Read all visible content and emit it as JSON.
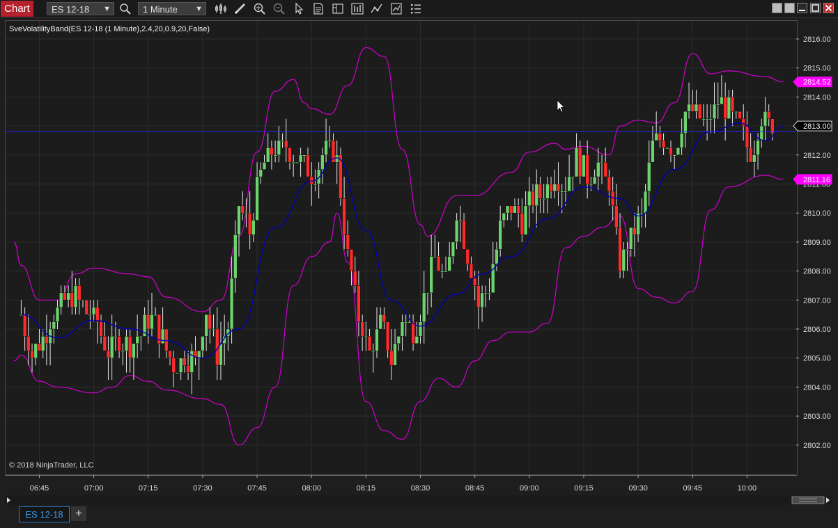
{
  "window": {
    "tab_label": "Chart",
    "instrument_dropdown": "ES 12-18",
    "interval_dropdown": "1 Minute",
    "toolbar_icons": [
      "search-icon",
      "bar-style-icon",
      "drawing-tools-icon",
      "zoom-in-icon",
      "zoom-out-icon",
      "select-pointer-icon",
      "data-box-icon",
      "chart-trader-icon",
      "indicators-icon",
      "strategies-icon",
      "properties-icon",
      "list-icon"
    ],
    "window_buttons": [
      "tile-left-icon",
      "tile-right-icon",
      "minimize-icon",
      "maximize-icon",
      "close-icon"
    ]
  },
  "chart": {
    "indicator_label": "SveVolatilityBand(ES 12-18 (1 Minute),2.4,20,0.9,20,False)",
    "copyright": "© 2018 NinjaTrader, LLC",
    "y_axis_labels": [
      "2816.00",
      "2815.00",
      "2814.00",
      "2813.00",
      "2812.00",
      "2811.00",
      "2810.00",
      "2809.00",
      "2808.00",
      "2807.00",
      "2806.00",
      "2805.00",
      "2804.00",
      "2803.00",
      "2802.00"
    ],
    "x_axis_labels": [
      "06:45",
      "07:00",
      "07:15",
      "07:30",
      "07:45",
      "08:00",
      "08:15",
      "08:30",
      "08:45",
      "09:00",
      "09:15",
      "09:30",
      "09:45",
      "10:00"
    ],
    "price_markers": [
      {
        "label": "2814.52",
        "value": 2814.52,
        "style": "upper-band",
        "color": "#ff00ff"
      },
      {
        "label": "2813.00",
        "value": 2813.0,
        "style": "last-price",
        "color": "#000000"
      },
      {
        "label": "2811.16",
        "value": 2811.16,
        "style": "lower-band",
        "color": "#ff00ff"
      }
    ]
  },
  "chart_data": {
    "type": "candlestick",
    "instrument": "ES 12-18",
    "interval": "1 Minute",
    "ylim": [
      2801.2,
      2816.7
    ],
    "x_range": [
      "06:38",
      "10:10"
    ],
    "grid": true,
    "colors": {
      "up": "#6cd46c",
      "down": "#ff2a2a",
      "band": "#d000d0",
      "middle": "#0000b4"
    },
    "close_path": [
      [
        "06:40",
        2806.4
      ],
      [
        "06:43",
        2805.1
      ],
      [
        "06:46",
        2805.7
      ],
      [
        "06:49",
        2806.5
      ],
      [
        "06:52",
        2806.9
      ],
      [
        "06:55",
        2807.2
      ],
      [
        "06:58",
        2806.6
      ],
      [
        "07:01",
        2806.2
      ],
      [
        "07:04",
        2805.3
      ],
      [
        "07:07",
        2805.6
      ],
      [
        "07:10",
        2805.4
      ],
      [
        "07:13",
        2805.9
      ],
      [
        "07:16",
        2806.4
      ],
      [
        "07:19",
        2805.6
      ],
      [
        "07:22",
        2804.8
      ],
      [
        "07:25",
        2805.0
      ],
      [
        "07:28",
        2804.9
      ],
      [
        "07:31",
        2806.6
      ],
      [
        "07:34",
        2805.2
      ],
      [
        "07:37",
        2806.0
      ],
      [
        "07:40",
        2810.2
      ],
      [
        "07:43",
        2809.4
      ],
      [
        "07:46",
        2811.4
      ],
      [
        "07:49",
        2812.1
      ],
      [
        "07:52",
        2812.3
      ],
      [
        "07:55",
        2812.0
      ],
      [
        "07:58",
        2811.7
      ],
      [
        "08:01",
        2811.3
      ],
      [
        "08:04",
        2812.2
      ],
      [
        "08:07",
        2811.9
      ],
      [
        "08:10",
        2808.5
      ],
      [
        "08:13",
        2806.5
      ],
      [
        "08:16",
        2805.2
      ],
      [
        "08:19",
        2806.2
      ],
      [
        "08:22",
        2805.0
      ],
      [
        "08:25",
        2806.3
      ],
      [
        "08:28",
        2805.9
      ],
      [
        "08:31",
        2807.0
      ],
      [
        "08:34",
        2808.5
      ],
      [
        "08:37",
        2807.5
      ],
      [
        "08:40",
        2810.2
      ],
      [
        "08:43",
        2808.6
      ],
      [
        "08:46",
        2806.9
      ],
      [
        "08:49",
        2807.5
      ],
      [
        "08:52",
        2809.5
      ],
      [
        "08:55",
        2810.2
      ],
      [
        "08:58",
        2809.8
      ],
      [
        "09:01",
        2810.5
      ],
      [
        "09:04",
        2810.7
      ],
      [
        "09:07",
        2811.4
      ],
      [
        "09:10",
        2810.9
      ],
      [
        "09:13",
        2812.0
      ],
      [
        "09:16",
        2811.3
      ],
      [
        "09:19",
        2811.6
      ],
      [
        "09:22",
        2811.0
      ],
      [
        "09:25",
        2808.2
      ],
      [
        "09:28",
        2809.2
      ],
      [
        "09:31",
        2809.9
      ],
      [
        "09:34",
        2812.4
      ],
      [
        "09:37",
        2812.6
      ],
      [
        "09:40",
        2812.1
      ],
      [
        "09:43",
        2813.6
      ],
      [
        "09:46",
        2813.4
      ],
      [
        "09:49",
        2813.1
      ],
      [
        "09:52",
        2813.8
      ],
      [
        "09:55",
        2813.5
      ],
      [
        "09:58",
        2812.9
      ],
      [
        "10:01",
        2812.0
      ],
      [
        "10:04",
        2813.3
      ],
      [
        "10:07",
        2813.0
      ]
    ],
    "middle_band": [
      [
        "06:40",
        2806.5
      ],
      [
        "06:50",
        2805.7
      ],
      [
        "07:00",
        2806.3
      ],
      [
        "07:10",
        2806.0
      ],
      [
        "07:20",
        2805.6
      ],
      [
        "07:30",
        2805.0
      ],
      [
        "07:40",
        2806.0
      ],
      [
        "07:50",
        2809.5
      ],
      [
        "08:00",
        2811.1
      ],
      [
        "08:07",
        2811.9
      ],
      [
        "08:15",
        2809.4
      ],
      [
        "08:22",
        2807.0
      ],
      [
        "08:30",
        2806.1
      ],
      [
        "08:40",
        2807.2
      ],
      [
        "08:47",
        2807.9
      ],
      [
        "08:55",
        2808.5
      ],
      [
        "09:05",
        2809.8
      ],
      [
        "09:15",
        2810.9
      ],
      [
        "09:25",
        2810.5
      ],
      [
        "09:30",
        2809.9
      ],
      [
        "09:40",
        2811.5
      ],
      [
        "09:50",
        2812.8
      ],
      [
        "09:58",
        2813.1
      ],
      [
        "10:05",
        2812.5
      ],
      [
        "10:10",
        2813.0
      ]
    ],
    "upper_band": [
      [
        "06:38",
        2809.0
      ],
      [
        "06:40",
        2808.2
      ],
      [
        "06:45",
        2807.0
      ],
      [
        "06:50",
        2807.0
      ],
      [
        "06:55",
        2807.9
      ],
      [
        "07:00",
        2808.1
      ],
      [
        "07:10",
        2807.9
      ],
      [
        "07:15",
        2807.8
      ],
      [
        "07:20",
        2807.1
      ],
      [
        "07:30",
        2806.6
      ],
      [
        "07:35",
        2807.0
      ],
      [
        "07:40",
        2809.2
      ],
      [
        "07:45",
        2812.1
      ],
      [
        "07:50",
        2814.2
      ],
      [
        "07:55",
        2814.6
      ],
      [
        "07:58",
        2813.8
      ],
      [
        "08:00",
        2813.6
      ],
      [
        "08:05",
        2813.4
      ],
      [
        "08:10",
        2814.4
      ],
      [
        "08:15",
        2815.7
      ],
      [
        "08:20",
        2815.4
      ],
      [
        "08:25",
        2812.2
      ],
      [
        "08:30",
        2809.6
      ],
      [
        "08:32",
        2809.2
      ],
      [
        "08:40",
        2810.6
      ],
      [
        "08:45",
        2810.6
      ],
      [
        "08:55",
        2811.4
      ],
      [
        "09:00",
        2812.1
      ],
      [
        "09:07",
        2812.4
      ],
      [
        "09:10",
        2812.2
      ],
      [
        "09:15",
        2812.3
      ],
      [
        "09:22",
        2812.0
      ],
      [
        "09:25",
        2813.0
      ],
      [
        "09:30",
        2813.2
      ],
      [
        "09:35",
        2813.1
      ],
      [
        "09:40",
        2813.8
      ],
      [
        "09:45",
        2815.5
      ],
      [
        "09:50",
        2814.8
      ],
      [
        "09:55",
        2814.9
      ],
      [
        "10:05",
        2814.7
      ],
      [
        "10:10",
        2814.52
      ]
    ],
    "lower_band": [
      [
        "06:38",
        2804.9
      ],
      [
        "06:40",
        2805.1
      ],
      [
        "06:45",
        2804.2
      ],
      [
        "06:50",
        2804.0
      ],
      [
        "07:00",
        2803.8
      ],
      [
        "07:05",
        2804.0
      ],
      [
        "07:10",
        2804.4
      ],
      [
        "07:15",
        2804.2
      ],
      [
        "07:20",
        2803.9
      ],
      [
        "07:30",
        2803.6
      ],
      [
        "07:35",
        2803.4
      ],
      [
        "07:40",
        2802.0
      ],
      [
        "07:45",
        2802.6
      ],
      [
        "07:50",
        2804.0
      ],
      [
        "07:55",
        2807.5
      ],
      [
        "08:00",
        2808.5
      ],
      [
        "08:05",
        2809.0
      ],
      [
        "08:07",
        2810.0
      ],
      [
        "08:10",
        2808.3
      ],
      [
        "08:15",
        2803.5
      ],
      [
        "08:20",
        2802.5
      ],
      [
        "08:25",
        2802.2
      ],
      [
        "08:30",
        2803.5
      ],
      [
        "08:35",
        2804.3
      ],
      [
        "08:40",
        2804.0
      ],
      [
        "08:45",
        2804.9
      ],
      [
        "08:50",
        2805.6
      ],
      [
        "08:55",
        2805.9
      ],
      [
        "09:00",
        2805.9
      ],
      [
        "09:05",
        2806.2
      ],
      [
        "09:10",
        2808.8
      ],
      [
        "09:15",
        2809.2
      ],
      [
        "09:20",
        2809.5
      ],
      [
        "09:25",
        2809.9
      ],
      [
        "09:30",
        2807.4
      ],
      [
        "09:35",
        2807.1
      ],
      [
        "09:40",
        2806.9
      ],
      [
        "09:45",
        2807.3
      ],
      [
        "09:50",
        2810.1
      ],
      [
        "09:55",
        2810.9
      ],
      [
        "10:05",
        2811.3
      ],
      [
        "10:10",
        2811.16
      ]
    ]
  },
  "bottom": {
    "tab_label": "ES 12-18",
    "add_tab_label": "+"
  }
}
